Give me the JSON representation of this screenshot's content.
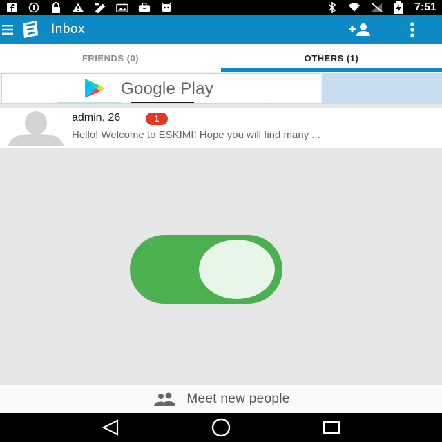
{
  "status_bar": {
    "time": "7:51",
    "left_icons": [
      "facebook-icon",
      "sync-icon",
      "lock-icon",
      "warning-icon",
      "fax-icon",
      "photo-icon",
      "briefcase-icon",
      "android-icon"
    ],
    "right_icons": [
      "bluetooth-icon",
      "wifi-icon",
      "signal-icon",
      "battery-charging-icon"
    ]
  },
  "app_bar": {
    "title": "Inbox",
    "color": "#0d8ac4"
  },
  "tabs": [
    {
      "label": "FRIENDS (0)",
      "active": false
    },
    {
      "label": "OTHERS (1)",
      "active": true
    }
  ],
  "ad": {
    "brand_text": "Google Play"
  },
  "messages": [
    {
      "name": "admin, 26",
      "unread": "1",
      "preview": "Hello! Welcome to ESKIMI! Hope you will find many ..."
    }
  ],
  "toggle": {
    "state": "on",
    "color": "#4caf50"
  },
  "footer": {
    "meet_label": "Meet new people"
  },
  "nav": [
    "back-icon",
    "home-icon",
    "recents-icon"
  ]
}
